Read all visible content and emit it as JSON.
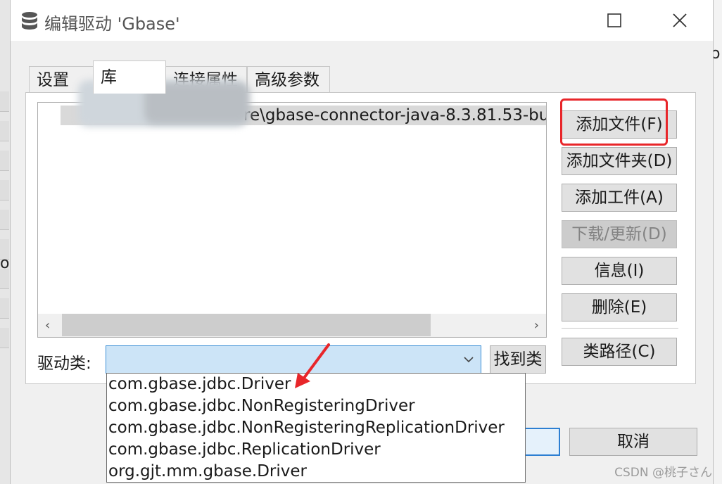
{
  "window": {
    "title": "编辑驱动 'Gbase'",
    "controls": [
      "maximize",
      "close"
    ]
  },
  "tabs": [
    {
      "label": "设置",
      "active": false
    },
    {
      "label": "库",
      "active": true
    },
    {
      "label": "连接属性",
      "active": false
    },
    {
      "label": "高级参数",
      "active": false
    }
  ],
  "library": {
    "files": [
      "re\\gbase-connector-java-8.3.81.53-bu"
    ]
  },
  "buttons": {
    "add_file": "添加文件(F)",
    "add_folder": "添加文件夹(D)",
    "add_artifact": "添加工件(A)",
    "download_update": "下载/更新(D)",
    "info": "信息(I)",
    "delete": "删除(E)",
    "classpath": "类路径(C)",
    "find_class": "找到类",
    "cancel": "取消"
  },
  "driver_class": {
    "label": "驱动类:",
    "value": "",
    "options": [
      "com.gbase.jdbc.Driver",
      "com.gbase.jdbc.NonRegisteringDriver",
      "com.gbase.jdbc.NonRegisteringReplicationDriver",
      "com.gbase.jdbc.ReplicationDriver",
      "org.gjt.mm.gbase.Driver"
    ]
  },
  "annotations": {
    "highlight_color": "#e8262a"
  },
  "watermark": "CSDN @桃子さん",
  "background": {
    "right_glyph": "o",
    "left_glyph": "o"
  }
}
